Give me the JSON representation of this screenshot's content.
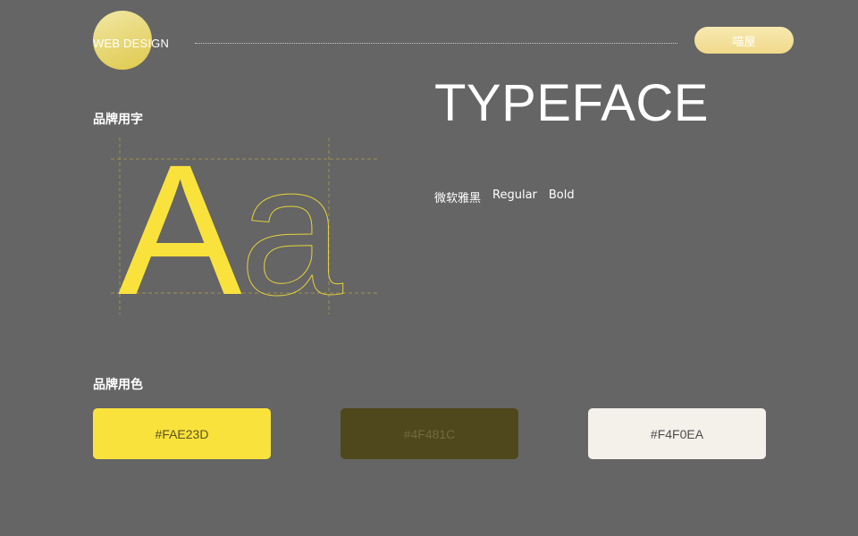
{
  "header": {
    "logo_text": "WEB DESIGN",
    "button_label": "喵屋"
  },
  "typeface_section": {
    "heading": "品牌用字",
    "title": "TYPEFACE",
    "font_name": "微软雅黑",
    "weight_regular": "Regular",
    "weight_bold": "Bold",
    "sample_upper": "A",
    "sample_lower": "a"
  },
  "color_section": {
    "heading": "品牌用色",
    "swatches": [
      {
        "label": "#FAE23D",
        "color": "#FAE23D"
      },
      {
        "label": "#4F481C",
        "color": "#4F481C"
      },
      {
        "label": "#F4F0EA",
        "color": "#F4F0EA"
      }
    ]
  },
  "colors": {
    "background": "#656565",
    "accent": "#FAE23D",
    "guide_line": "#9a9151"
  }
}
